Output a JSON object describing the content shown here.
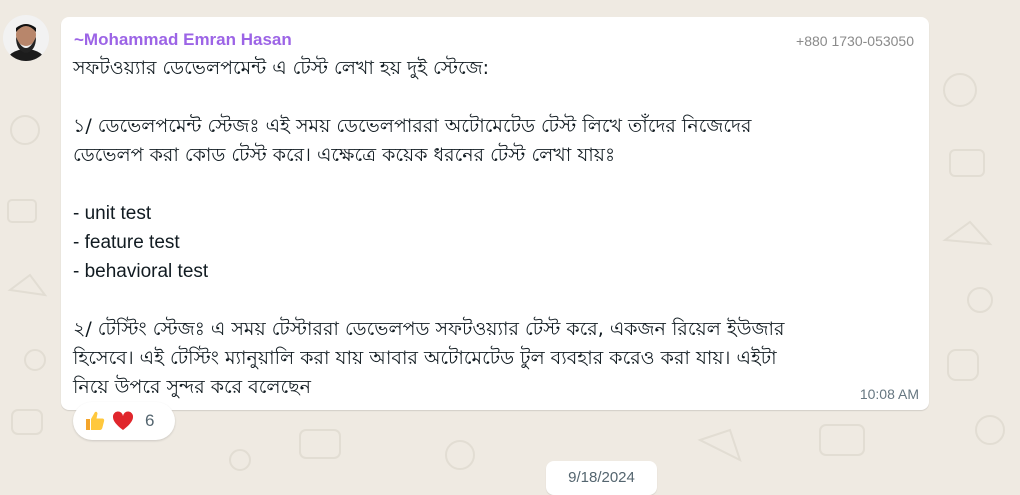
{
  "message": {
    "sender_name": "~Mohammad Emran Hasan",
    "sender_phone": "+880 1730-053050",
    "lines": {
      "l1": "সফটওয়্যার ডেভেলপমেন্ট এ টেস্ট লেখা হয় দুই স্টেজে:",
      "l2": "১/ ডেভেলপমেন্ট স্টেজঃ এই সময় ডেভেলপাররা অটোমেটেড টেস্ট লিখে তাঁদের নিজেদের",
      "l3": "ডেভেলপ করা কোড টেস্ট করে। এক্ষেত্রে কয়েক ধরনের টেস্ট লেখা যায়ঃ",
      "l4": "- unit test",
      "l5": "- feature test",
      "l6": "- behavioral test",
      "l7": "২/ টেস্টিং স্টেজঃ এ সময় টেস্টাররা ডেভেলপড সফটওয়্যার টেস্ট করে, একজন রিয়েল ইউজার",
      "l8": "হিসেবে। এই টেস্টিং ম্যানুয়ালি করা যায় আবার অটোমেটেড টুল ব্যবহার করেও করা যায়। এইটা",
      "l9": "নিয়ে উপরে সুন্দর করে বলেছেন"
    },
    "time": "10:08 AM"
  },
  "reactions": {
    "emojis": [
      "thumbs-up-icon",
      "red-heart-icon"
    ],
    "count": "6"
  },
  "date_divider": "9/18/2024",
  "colors": {
    "background": "#efeae2",
    "bubble": "#ffffff",
    "sender_name": "#9c64e6",
    "phone": "#8a8a8a",
    "text": "#111b21",
    "timestamp": "#667781"
  }
}
